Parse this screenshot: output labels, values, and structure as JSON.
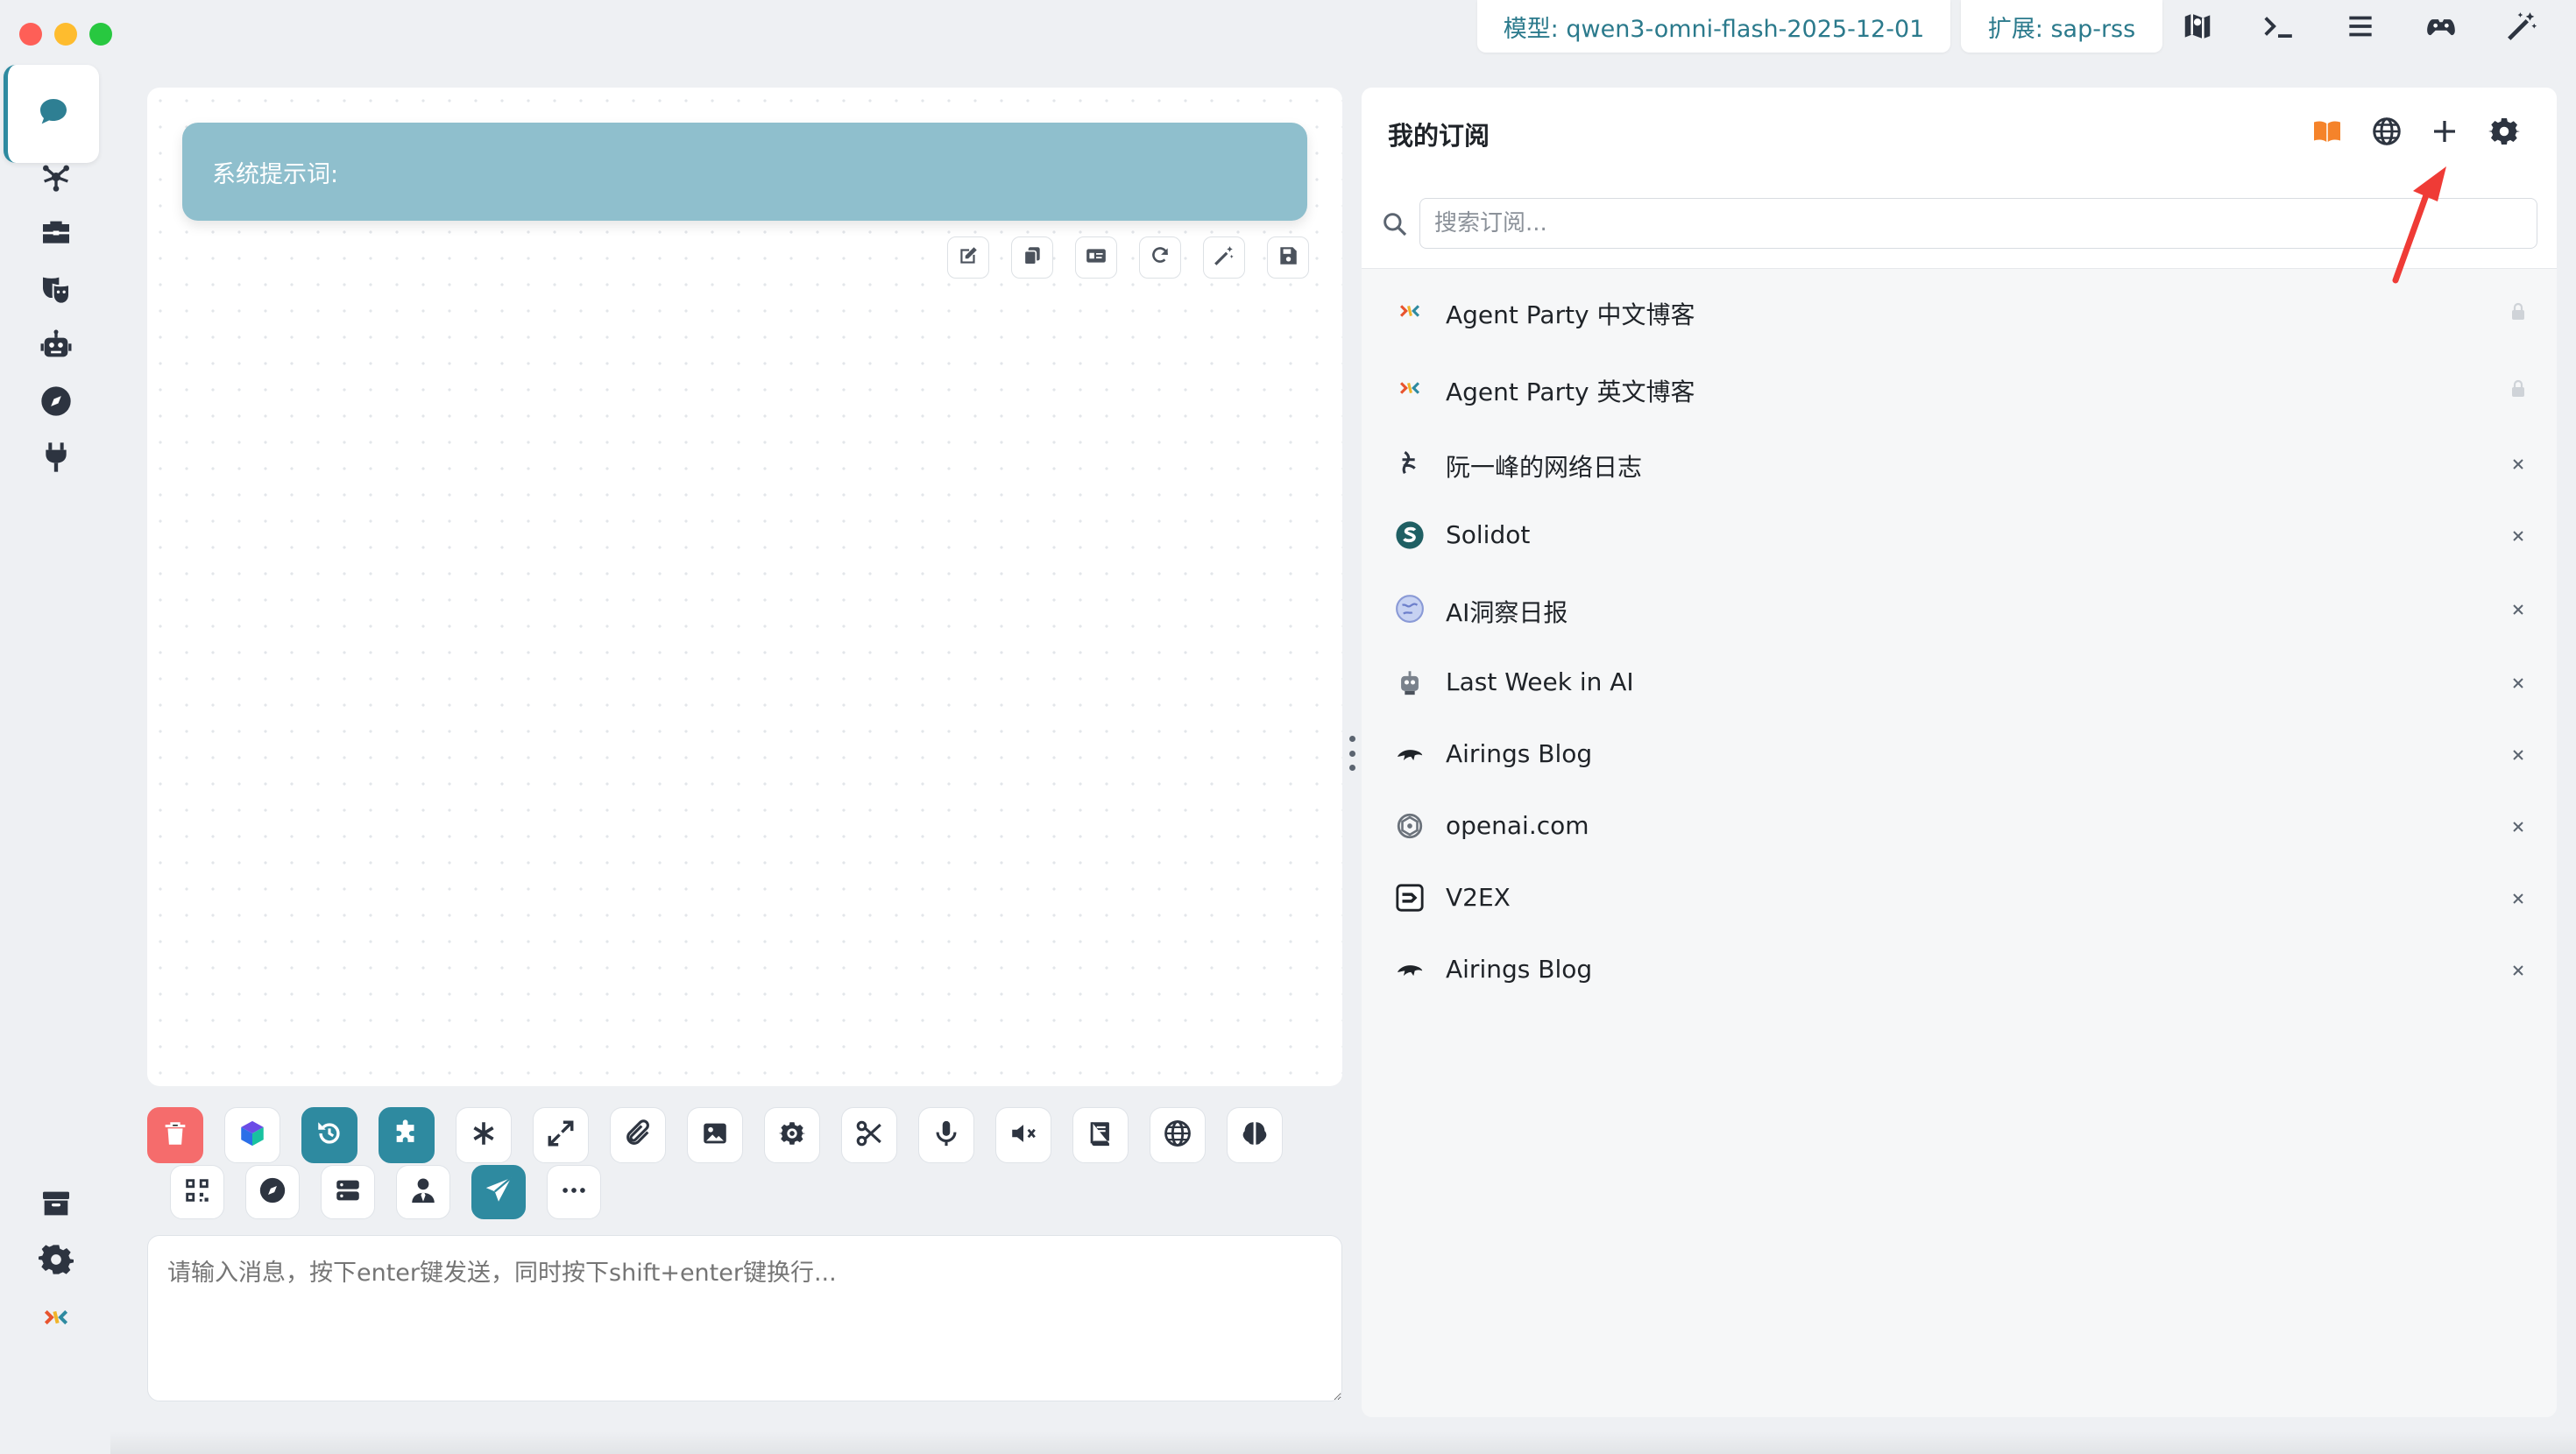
{
  "window": {
    "model_chip": "模型: qwen3-omni-flash-2025-12-01",
    "extension_chip": "扩展: sap-rss",
    "top_icons": [
      "map-icon",
      "terminal-icon",
      "menu-icon",
      "gamepad-icon",
      "magic-wand-icon"
    ]
  },
  "nav": {
    "items": [
      "chat-icon",
      "network-icon",
      "toolbox-icon",
      "masks-icon",
      "robot-icon",
      "compass-icon",
      "plug-icon"
    ],
    "bottom": [
      "archive-icon",
      "settings-icon",
      "app-logo-icon"
    ]
  },
  "chat": {
    "system_prompt_label": "系统提示词:",
    "system_prompt_tools": [
      "edit-icon",
      "copy-icon",
      "id-card-icon",
      "refresh-icon",
      "magic-icon",
      "save-icon"
    ],
    "input_placeholder": "请输入消息，按下enter键发送，同时按下shift+enter键换行..."
  },
  "toolbar": {
    "row1": [
      "trash-icon",
      "model-logo-icon",
      "history-icon",
      "puzzle-icon",
      "asterisk-icon",
      "expand-icon",
      "paperclip-icon",
      "image-icon",
      "atom-icon",
      "scissors-icon",
      "microphone-icon",
      "mute-icon",
      "book-icon",
      "globe-icon",
      "brain-icon"
    ],
    "row2": [
      "qrcode-icon",
      "compass-icon",
      "server-icon",
      "user-tie-icon",
      "send-icon",
      "more-icon"
    ]
  },
  "subscriptions": {
    "title": "我的订阅",
    "search_placeholder": "搜索订阅...",
    "header_icons": [
      "book-open-icon",
      "globe-icon",
      "plus-icon",
      "gear-icon"
    ],
    "items": [
      {
        "label": "Agent Party 中文博客",
        "action": "lock"
      },
      {
        "label": "Agent Party 英文博客",
        "action": "lock"
      },
      {
        "label": "阮一峰的网络日志",
        "action": "close"
      },
      {
        "label": "Solidot",
        "action": "close"
      },
      {
        "label": "AI洞察日报",
        "action": "close"
      },
      {
        "label": "Last Week in AI",
        "action": "close"
      },
      {
        "label": "Airings Blog",
        "action": "close"
      },
      {
        "label": "openai.com",
        "action": "close"
      },
      {
        "label": "V2EX",
        "action": "close"
      },
      {
        "label": "Airings Blog",
        "action": "close"
      }
    ]
  },
  "colors": {
    "accent": "#2e8aa0",
    "system_prompt_bg": "#8fbfcd",
    "danger": "#f56c6c",
    "book_orange": "#f5832a",
    "annotation_red": "#ef3b36"
  }
}
